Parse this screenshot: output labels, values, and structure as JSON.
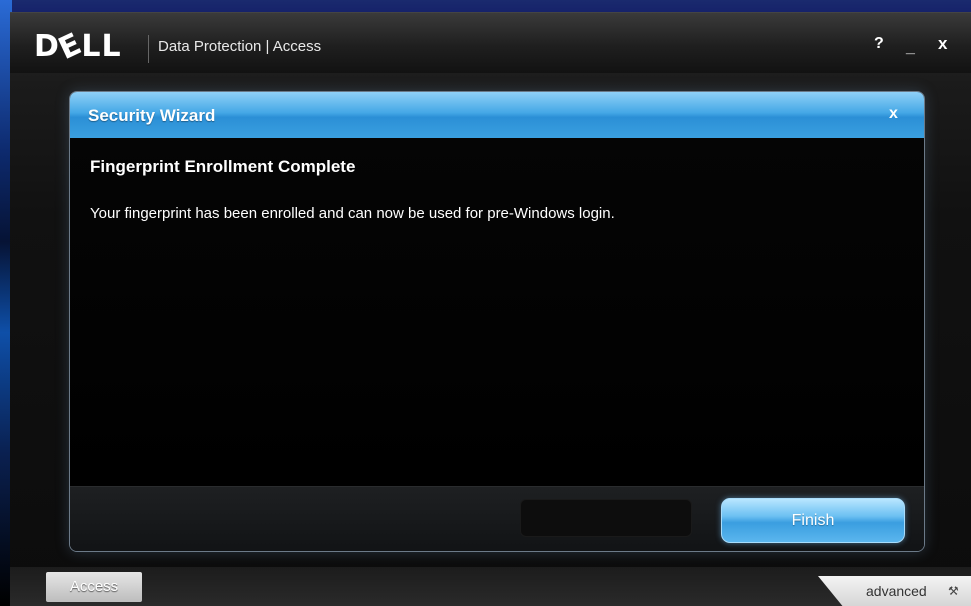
{
  "app": {
    "logo_text": "DELL",
    "title": "Data Protection | Access",
    "help_label": "?",
    "minimize_label": "_",
    "close_label": "x"
  },
  "wizard": {
    "title": "Security Wizard",
    "close_label": "x",
    "heading": "Fingerprint Enrollment Complete",
    "message": "Your fingerprint has been enrolled and can now be used for pre-Windows login.",
    "finish_label": "Finish"
  },
  "bottom_bar": {
    "access_tab_label": "Access",
    "advanced_label": "advanced",
    "advanced_icon": "wrench-icon"
  },
  "colors": {
    "header_blue": "#3aa0e0",
    "finish_blue": "#5bb6ee",
    "background": "#000000"
  }
}
